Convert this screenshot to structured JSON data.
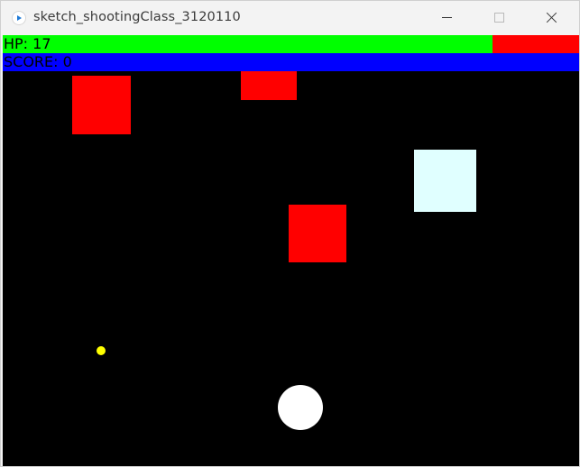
{
  "window": {
    "title": "sketch_shootingClass_3120110",
    "controls": [
      "minimize-icon",
      "maximize-icon",
      "close-icon"
    ]
  },
  "hud": {
    "hp_label": "HP: 17",
    "hp_fraction": 0.85,
    "score_label": "SCORE: 0"
  },
  "colors": {
    "hp_fill": "#00ff00",
    "hp_empty": "#ff0000",
    "score_bar": "#0000ff",
    "background": "#000000",
    "enemy": "#ff0000",
    "pickup": "#e0ffff",
    "bullet": "#ffff00",
    "player": "#ffffff"
  }
}
